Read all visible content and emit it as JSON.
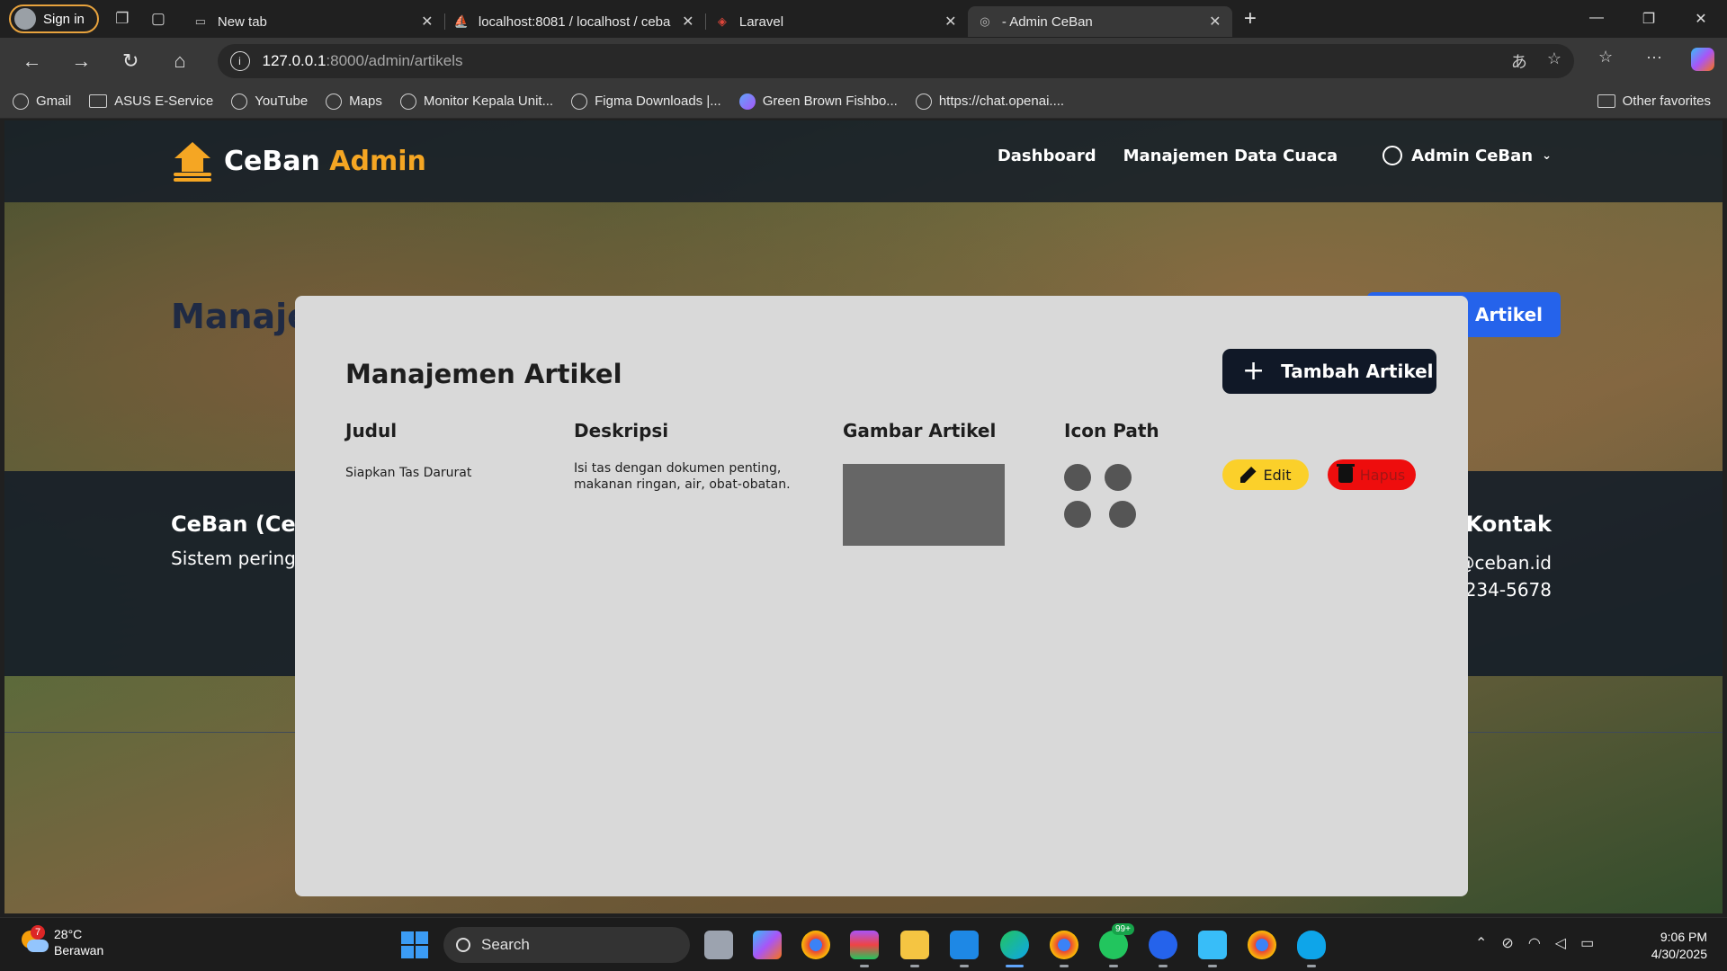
{
  "browser": {
    "signin_label": "Sign in",
    "tabs": [
      {
        "label": "New tab",
        "icon": "newtab-icon",
        "active": false
      },
      {
        "label": "localhost:8081 / localhost / ceban",
        "icon": "phpmyadmin-icon",
        "active": false
      },
      {
        "label": "Laravel",
        "icon": "laravel-icon",
        "active": false
      },
      {
        "label": "- Admin CeBan",
        "icon": "globe-icon",
        "active": true
      }
    ],
    "address": {
      "host": "127.0.0.1",
      "path": ":8000/admin/artikels"
    },
    "bookmarks": [
      {
        "label": "Gmail",
        "icon": "globe-icon"
      },
      {
        "label": "ASUS E-Service",
        "icon": "folder-icon"
      },
      {
        "label": "YouTube",
        "icon": "globe-icon"
      },
      {
        "label": "Maps",
        "icon": "globe-icon"
      },
      {
        "label": "Monitor Kepala Unit...",
        "icon": "globe-icon"
      },
      {
        "label": "Figma Downloads |...",
        "icon": "globe-icon"
      },
      {
        "label": "Green Brown Fishbo...",
        "icon": "canva-icon"
      },
      {
        "label": "https://chat.openai....",
        "icon": "globe-icon"
      }
    ],
    "other_favorites": "Other favorites"
  },
  "site": {
    "brand": "CeBan",
    "brand_accent": "Admin",
    "nav": {
      "dashboard": "Dashboard",
      "weather": "Manajemen Data Cuaca"
    },
    "user": "Admin CeBan",
    "bg_title": "Manaje",
    "bg_add_button": "h Artikel",
    "footer": {
      "brand": "CeBan (Ce",
      "desc": "Sistem pering",
      "contact_heading": "Kontak",
      "email": "@ceban.id",
      "phone": "234-5678"
    },
    "colors": {
      "accent": "#f5a623",
      "primary": "#2563eb",
      "dark": "#101827"
    }
  },
  "modal": {
    "title": "Manajemen Artikel",
    "add_button": "Tambah Artikel",
    "columns": {
      "judul": "Judul",
      "deskripsi": "Deskripsi",
      "gambar": "Gambar Artikel",
      "icon_path": "Icon Path"
    },
    "rows": [
      {
        "judul": "Siapkan Tas Darurat",
        "deskripsi_line1": "Isi tas dengan dokumen penting,",
        "deskripsi_line2": "makanan ringan, air, obat-obatan.",
        "edit_label": "Edit",
        "delete_label": "Hapus"
      }
    ]
  },
  "taskbar": {
    "weather_temp": "28°C",
    "weather_desc": "Berawan",
    "weather_badge": "7",
    "search_label": "Search",
    "whatsapp_badge": "99+",
    "time": "9:06 PM",
    "date": "4/30/2025"
  }
}
